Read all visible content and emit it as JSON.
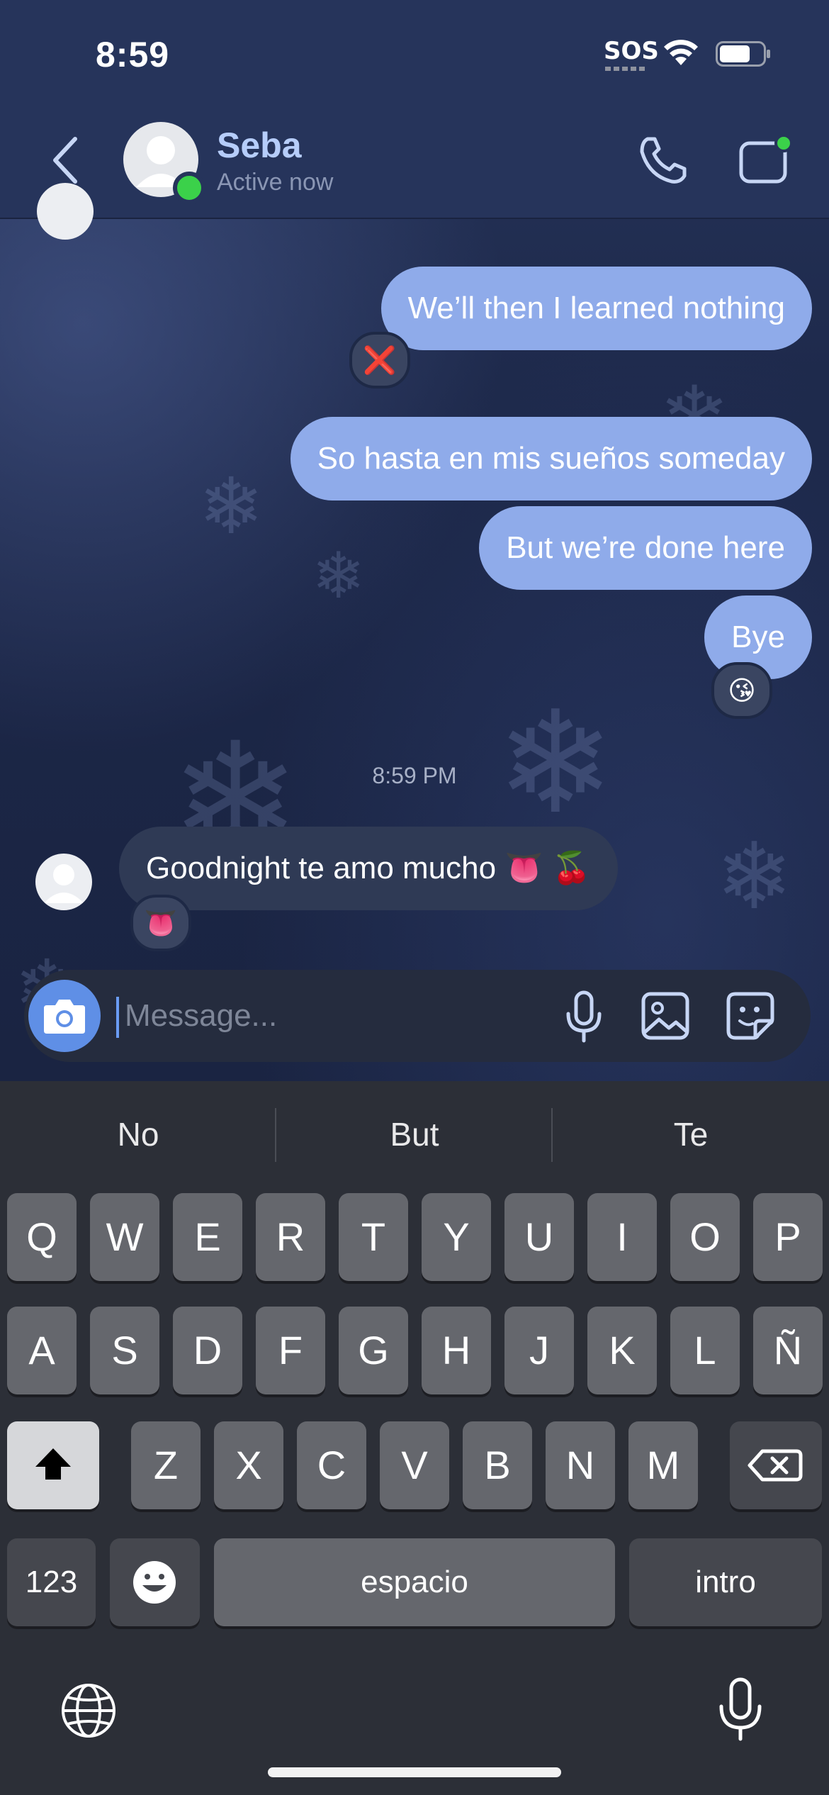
{
  "status_bar": {
    "time": "8:59",
    "sos": "SOS"
  },
  "header": {
    "name": "Seba",
    "status": "Active now"
  },
  "messages": [
    {
      "side": "out",
      "text": "We’ll then I learned nothing",
      "reaction": "❌"
    },
    {
      "side": "out",
      "text": "So hasta en mis sueños someday",
      "reaction": ""
    },
    {
      "side": "out",
      "text": "But we’re done here",
      "reaction": ""
    },
    {
      "side": "out",
      "text": "Bye",
      "reaction": "😘"
    },
    {
      "side": "in",
      "text": "Goodnight te amo mucho 👅 🍒",
      "reaction": "👅"
    }
  ],
  "timestamp": "8:59 PM",
  "composer": {
    "placeholder": "Message..."
  },
  "keyboard": {
    "suggestions": [
      "No",
      "But",
      "Te"
    ],
    "row1": [
      "Q",
      "W",
      "E",
      "R",
      "T",
      "Y",
      "U",
      "I",
      "O",
      "P"
    ],
    "row2": [
      "A",
      "S",
      "D",
      "F",
      "G",
      "H",
      "J",
      "K",
      "L",
      "Ñ"
    ],
    "row3": [
      "Z",
      "X",
      "C",
      "V",
      "B",
      "N",
      "M"
    ],
    "numbers_label": "123",
    "space_label": "espacio",
    "return_label": "intro"
  },
  "colors": {
    "outgoing_bubble": "#8fabea",
    "incoming_bubble": "#2f3a55",
    "online": "#3bd14a",
    "accent": "#5f8fe6"
  }
}
